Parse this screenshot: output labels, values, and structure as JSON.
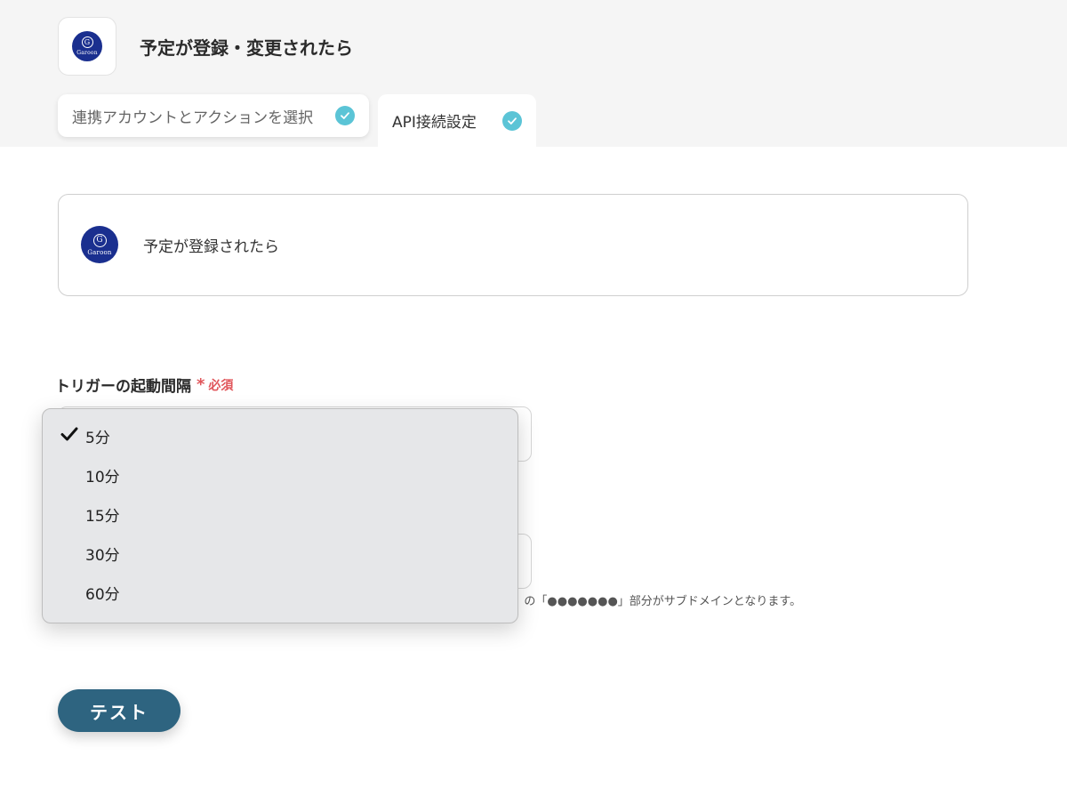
{
  "header": {
    "title": "予定が登録・変更されたら",
    "logo_word": "Garoon",
    "logo_letter": "G"
  },
  "tabs": [
    {
      "label": "連携アカウントとアクションを選択",
      "completed": true
    },
    {
      "label": "API接続設定",
      "completed": true
    }
  ],
  "trigger_card": {
    "text": "予定が登録されたら",
    "logo_word": "Garoon",
    "logo_letter": "G"
  },
  "interval_field": {
    "label": "トリガーの起動間隔",
    "required_mark": "*",
    "required_text": "必須",
    "selected": "5分",
    "options": [
      "5分",
      "10分",
      "15分",
      "30分",
      "60分"
    ]
  },
  "subdomain_hint": "/」の「●●●●●●●」部分がサブドメインとなります。",
  "test_button": "テスト",
  "colors": {
    "header_bg": "#f5f5f5",
    "check": "#5bc4d6",
    "button": "#2e6480",
    "required": "#e0555a",
    "logo": "#1a2f8f"
  }
}
